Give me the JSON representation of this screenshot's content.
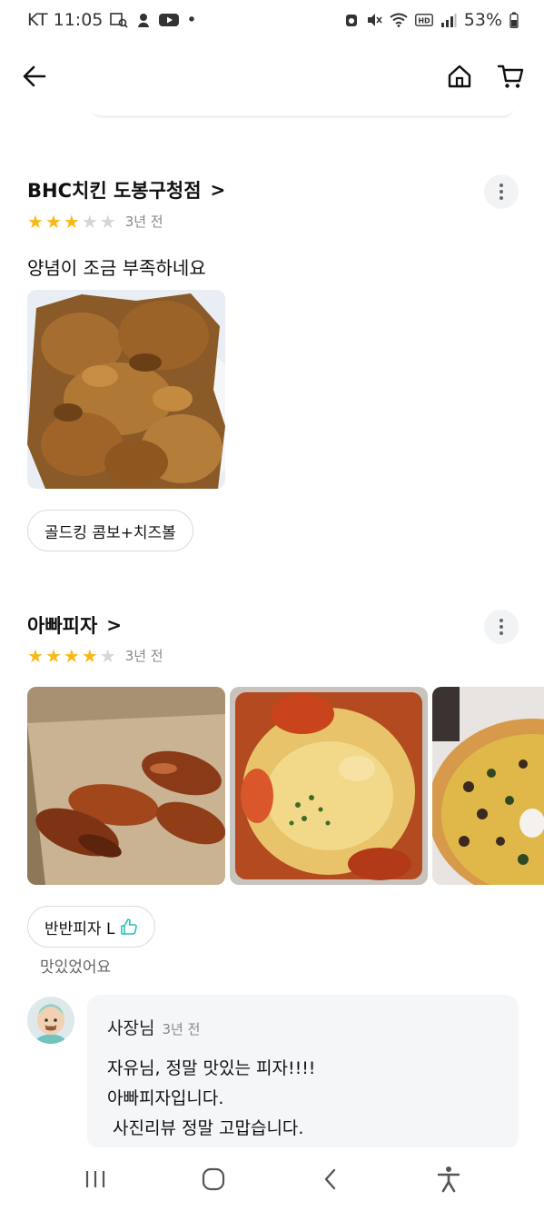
{
  "status_bar": {
    "carrier_time": "KT 11:05",
    "dot": "•",
    "battery": "53%",
    "icons": [
      "image-search-icon",
      "mascot-icon",
      "youtube-icon",
      "alarm-icon",
      "mute-icon",
      "wifi-icon",
      "hd-icon",
      "signal-icon",
      "battery-icon"
    ]
  },
  "header": {
    "back_icon": "arrow-left-icon",
    "home_icon": "home-icon",
    "cart_icon": "cart-icon"
  },
  "reviews": [
    {
      "store_name": "BHC치킨 도봉구청점",
      "chevron": ">",
      "rating": 3,
      "max_rating": 5,
      "time_ago": "3년 전",
      "text": "양념이 조금 부족하네요",
      "photos": [
        "fried-chicken-photo"
      ],
      "menu_chip": "골드킹 콤보+치즈볼"
    },
    {
      "store_name": "아빠피자",
      "chevron": ">",
      "rating": 4,
      "max_rating": 5,
      "time_ago": "3년 전",
      "photos": [
        "chicken-wings-box-photo",
        "cheese-pizza-photo",
        "topping-pizza-photo"
      ],
      "menu_chip": "반반피자 L",
      "menu_chip_icon": "thumbs-up-icon",
      "chip_comment": "맛있었어요",
      "owner_reply": {
        "name": "사장님",
        "time_ago": "3년 전",
        "lines": [
          "자유님, 정말 맛있는 피자!!!!",
          "아빠피자입니다.",
          " 사진리뷰 정말 고맙습니다."
        ]
      }
    }
  ],
  "nav_bar": {
    "icons": [
      "recent-apps-icon",
      "home-circle-icon",
      "back-chevron-icon",
      "accessibility-icon"
    ]
  },
  "colors": {
    "star_on": "#f7b917",
    "star_off": "#d6d6d6",
    "thumbs_up": "#2ac1bc",
    "bubble_bg": "#f5f6f8"
  }
}
